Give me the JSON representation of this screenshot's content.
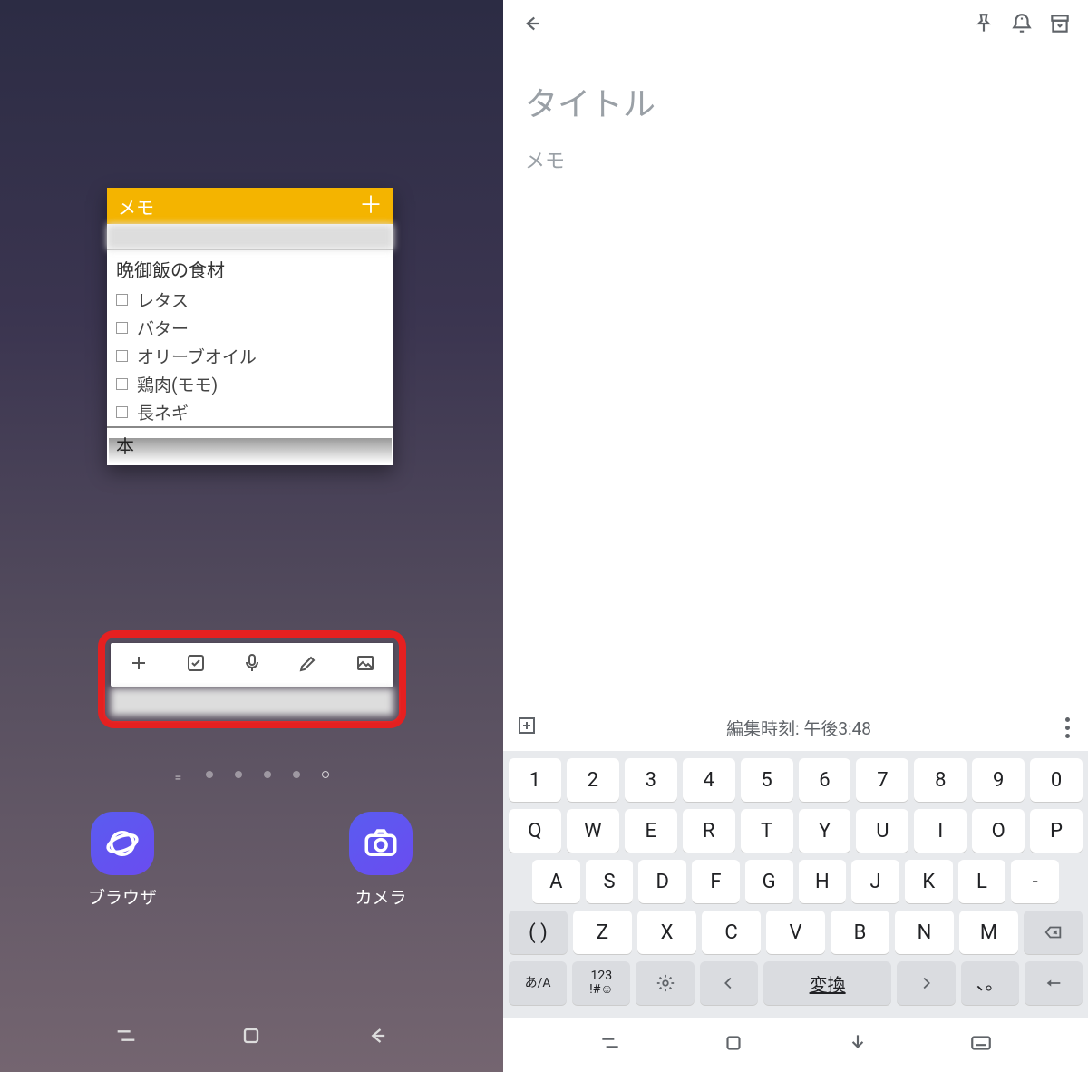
{
  "left": {
    "widget": {
      "header_label": "メモ",
      "list_title": "晩御飯の食材",
      "items": [
        "レタス",
        "バター",
        "オリーブオイル",
        "鶏肉(モモ)",
        "長ネギ"
      ],
      "second_note": "本"
    },
    "apps": {
      "browser": "ブラウザ",
      "camera": "カメラ"
    }
  },
  "right": {
    "title_placeholder": "タイトル",
    "memo_placeholder": "メモ",
    "edit_time": "編集時刻: 午後3:48",
    "keyboard": {
      "row0": [
        "1",
        "2",
        "3",
        "4",
        "5",
        "6",
        "7",
        "8",
        "9",
        "0"
      ],
      "row1": [
        "Q",
        "W",
        "E",
        "R",
        "T",
        "Y",
        "U",
        "I",
        "O",
        "P"
      ],
      "row2": [
        "A",
        "S",
        "D",
        "F",
        "G",
        "H",
        "J",
        "K",
        "L",
        "-"
      ],
      "row3": [
        "( )",
        "Z",
        "X",
        "C",
        "V",
        "B",
        "N",
        "M"
      ],
      "bottom": {
        "mode": "あ/A",
        "sym": "123\n!#☺",
        "convert": "変換",
        "dots": "、。"
      }
    }
  }
}
